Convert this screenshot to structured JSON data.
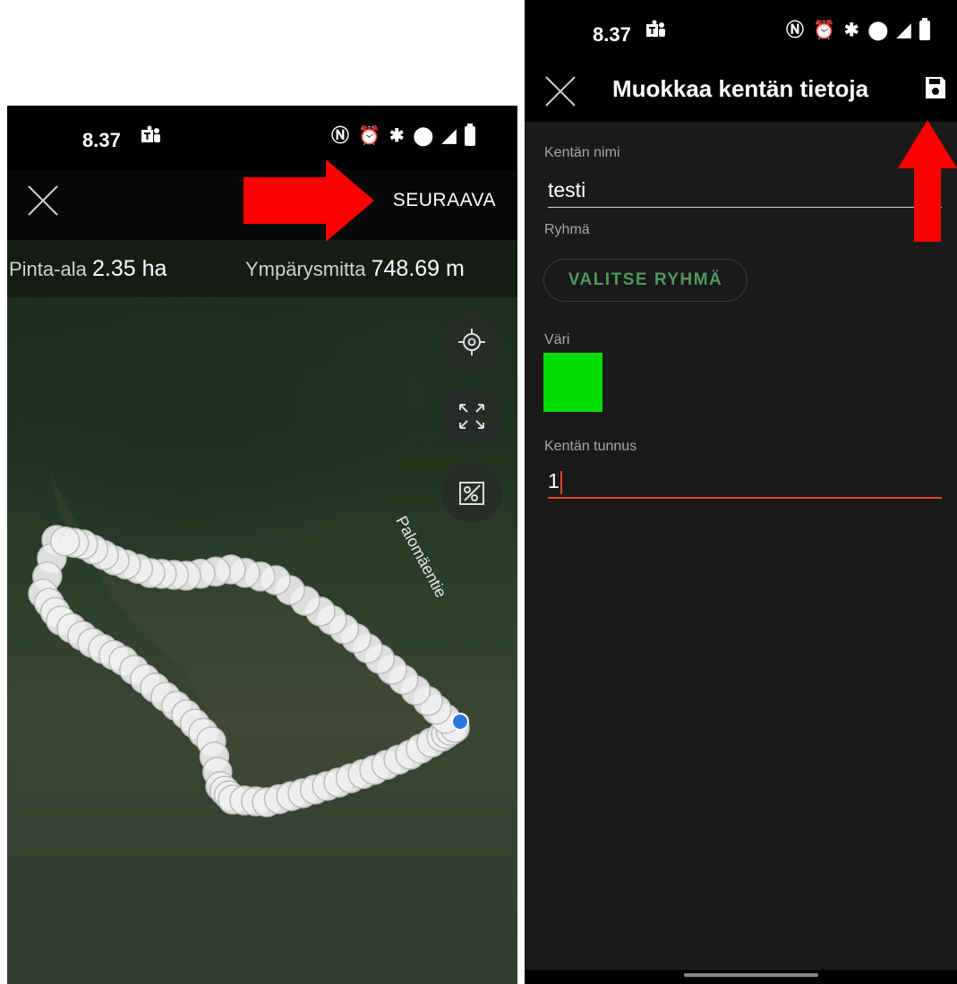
{
  "left_screen": {
    "status": {
      "time": "8.37"
    },
    "next_label": "SEURAAVA",
    "area_label": "Pinta-ala",
    "area_value": "2.35 ha",
    "perimeter_label": "Ympärysmitta",
    "perimeter_value": "748.69 m",
    "road_name": "Palomäentie",
    "icons": [
      "close-icon",
      "locate-icon",
      "expand-icon",
      "edit-field-icon"
    ]
  },
  "right_screen": {
    "status": {
      "time": "8.37"
    },
    "title": "Muokkaa kentän tietoja",
    "field_name_label": "Kentän nimi",
    "field_name_value": "testi",
    "group_label": "Ryhmä",
    "group_button": "VALITSE RYHMÄ",
    "color_label": "Väri",
    "field_id_label": "Kentän tunnus",
    "field_id_value": "1",
    "icons": [
      "close-icon",
      "save-icon"
    ]
  },
  "colors": {
    "field_color": "#00dd00",
    "accent_green": "#4e9a5c",
    "active_underline": "#e04b2a",
    "annotation_arrow": "#ff0000"
  }
}
